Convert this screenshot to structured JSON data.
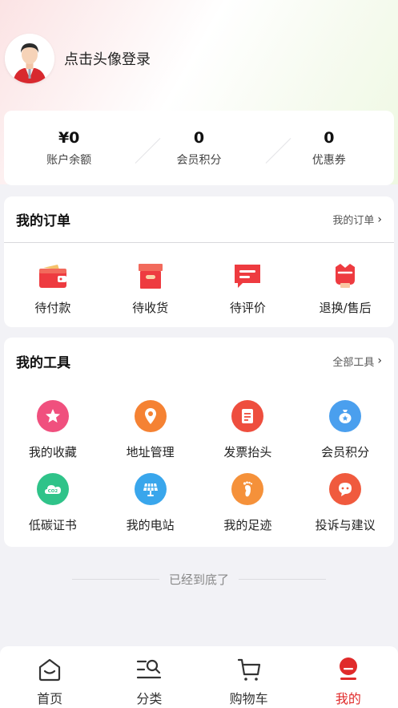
{
  "profile": {
    "login_text": "点击头像登录"
  },
  "stats": [
    {
      "value": "¥0",
      "label": "账户余额"
    },
    {
      "value": "0",
      "label": "会员积分"
    },
    {
      "value": "0",
      "label": "优惠券"
    }
  ],
  "orders": {
    "title": "我的订单",
    "link": "我的订单",
    "items": [
      {
        "label": "待付款",
        "icon": "wallet-icon"
      },
      {
        "label": "待收货",
        "icon": "box-icon"
      },
      {
        "label": "待评价",
        "icon": "comment-icon"
      },
      {
        "label": "退换/售后",
        "icon": "return-icon"
      }
    ]
  },
  "tools": {
    "title": "我的工具",
    "link": "全部工具",
    "items": [
      {
        "label": "我的收藏",
        "icon": "star-icon",
        "color": "#f0507e"
      },
      {
        "label": "地址管理",
        "icon": "location-icon",
        "color": "#f58233"
      },
      {
        "label": "发票抬头",
        "icon": "invoice-icon",
        "color": "#ee4e3e"
      },
      {
        "label": "会员积分",
        "icon": "points-bag-icon",
        "color": "#4a9fee"
      },
      {
        "label": "低碳证书",
        "icon": "co2-icon",
        "color": "#2fc389"
      },
      {
        "label": "我的电站",
        "icon": "solar-panel-icon",
        "color": "#39a6ec"
      },
      {
        "label": "我的足迹",
        "icon": "footprint-icon",
        "color": "#f5913a"
      },
      {
        "label": "投诉与建议",
        "icon": "message-icon",
        "color": "#f05a3e"
      }
    ]
  },
  "end_text": "已经到底了",
  "tabbar": {
    "items": [
      {
        "label": "首页",
        "icon": "home-icon"
      },
      {
        "label": "分类",
        "icon": "category-search-icon"
      },
      {
        "label": "购物车",
        "icon": "cart-icon"
      },
      {
        "label": "我的",
        "icon": "profile-icon"
      }
    ],
    "active_index": 3,
    "active_color": "#e02a2a"
  }
}
